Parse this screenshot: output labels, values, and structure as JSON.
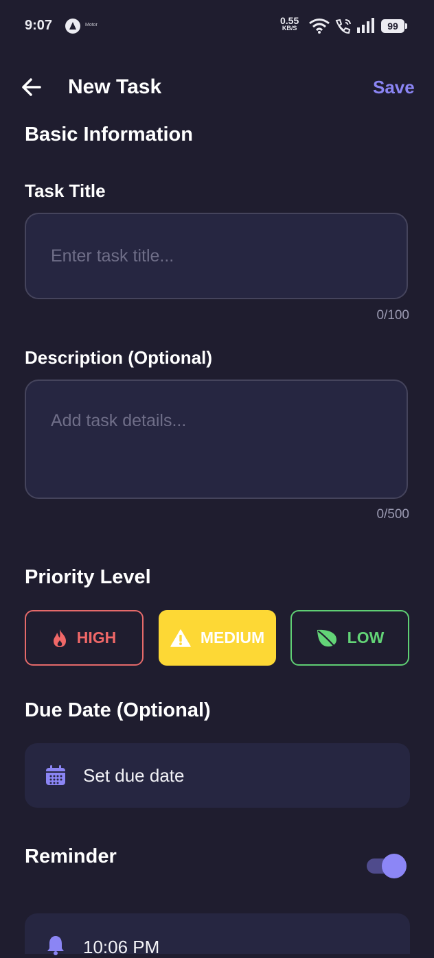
{
  "status_bar": {
    "time": "9:07",
    "app_tag": "Motor",
    "net_speed_value": "0.55",
    "net_speed_unit": "KB/S",
    "battery": "99",
    "icons": [
      "app-a-icon",
      "wifi-icon",
      "wifi-call-icon",
      "signal-icon",
      "battery-icon"
    ]
  },
  "header": {
    "title": "New Task",
    "save_label": "Save"
  },
  "section_title": "Basic Information",
  "task_title": {
    "label": "Task Title",
    "placeholder": "Enter task title...",
    "value": "",
    "counter": "0/100"
  },
  "description": {
    "label": "Description (Optional)",
    "placeholder": "Add task details...",
    "value": "",
    "counter": "0/500"
  },
  "priority": {
    "label": "Priority Level",
    "selected": "MEDIUM",
    "options": [
      {
        "label": "HIGH",
        "icon": "flame-icon",
        "color": "#f06868"
      },
      {
        "label": "MEDIUM",
        "icon": "warning-icon",
        "color": "#fdd835"
      },
      {
        "label": "LOW",
        "icon": "leaf-icon",
        "color": "#63d477"
      }
    ]
  },
  "due_date": {
    "label": "Due Date (Optional)",
    "button_text": "Set due date",
    "icon": "calendar-icon"
  },
  "reminder": {
    "label": "Reminder",
    "enabled": true,
    "time": "10:06 PM",
    "icon": "bell-icon"
  },
  "colors": {
    "background": "#1f1d2f",
    "card": "#262641",
    "accent": "#8b85f4"
  }
}
